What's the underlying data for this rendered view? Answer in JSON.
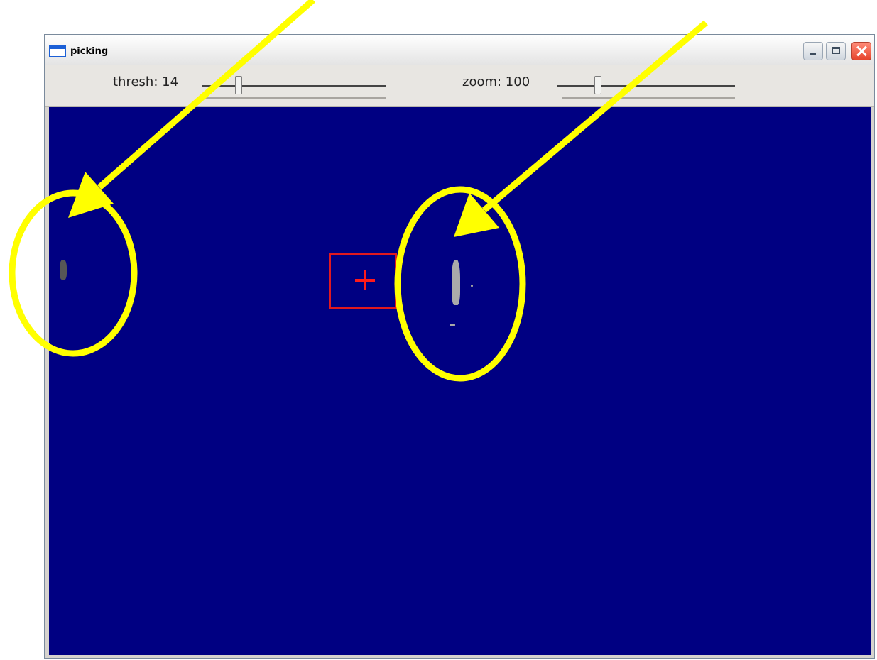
{
  "window": {
    "title": "picking"
  },
  "toolbar": {
    "thresh_label": "thresh: 14",
    "thresh_value": 14,
    "zoom_label": "zoom: 100",
    "zoom_value": 100
  },
  "colors": {
    "canvas_background": "#000082",
    "crosshair": "#ff1a1a",
    "annotation": "#ffff00"
  },
  "icons": {
    "app": "window-icon",
    "minimize": "minimize-icon",
    "maximize": "maximize-icon",
    "close": "close-icon",
    "target": "crosshair-icon"
  }
}
